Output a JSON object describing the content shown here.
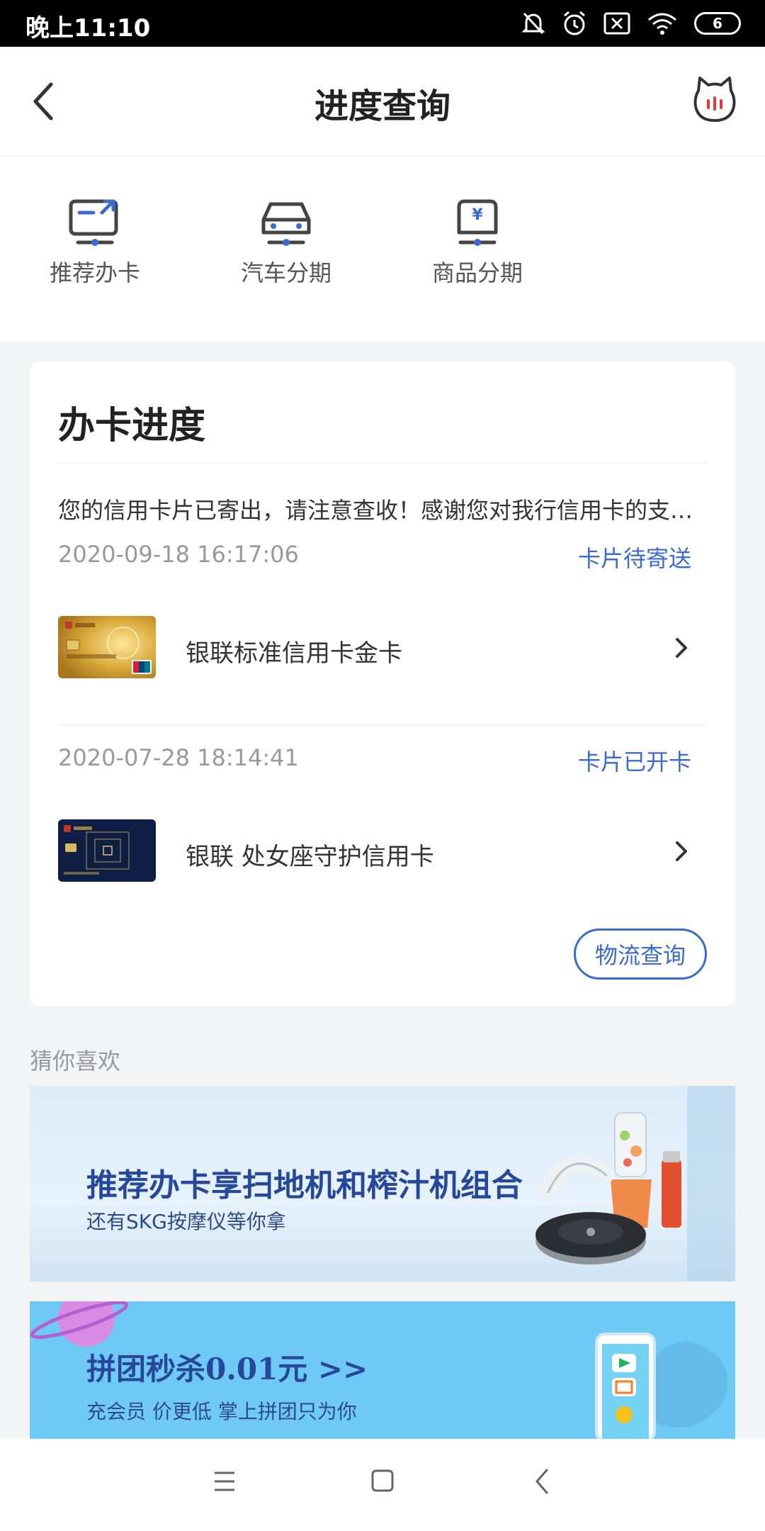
{
  "status_bar": {
    "time": "晚上11:10",
    "battery": "6"
  },
  "header": {
    "title": "进度查询"
  },
  "quick_tabs": [
    {
      "label": "推荐办卡",
      "icon": "card-share-icon"
    },
    {
      "label": "汽车分期",
      "icon": "car-icon"
    },
    {
      "label": "商品分期",
      "icon": "yen-bag-icon"
    }
  ],
  "progress": {
    "title": "办卡进度",
    "notice": "您的信用卡片已寄出，请注意查收！感谢您对我行信用卡的支持与厚爱！",
    "records": [
      {
        "date": "2020-09-18 16:17:06",
        "status": "卡片待寄送",
        "card_name": "银联标准信用卡金卡"
      },
      {
        "date": "2020-07-28 18:14:41",
        "status": "卡片已开卡",
        "card_name": "银联 处女座守护信用卡"
      }
    ],
    "logistics_button": "物流查询"
  },
  "recommend": {
    "title": "猜你喜欢",
    "banners": [
      {
        "title": "推荐办卡享扫地机和榨汁机组合",
        "subtitle": "还有SKG按摩仪等你拿"
      },
      {
        "title": "拼团秒杀0.01元 >>",
        "subtitle": "充会员 价更低  掌上拼团只为你"
      }
    ]
  },
  "colors": {
    "accent": "#3b6bd1",
    "banner_title": "#27489a"
  }
}
